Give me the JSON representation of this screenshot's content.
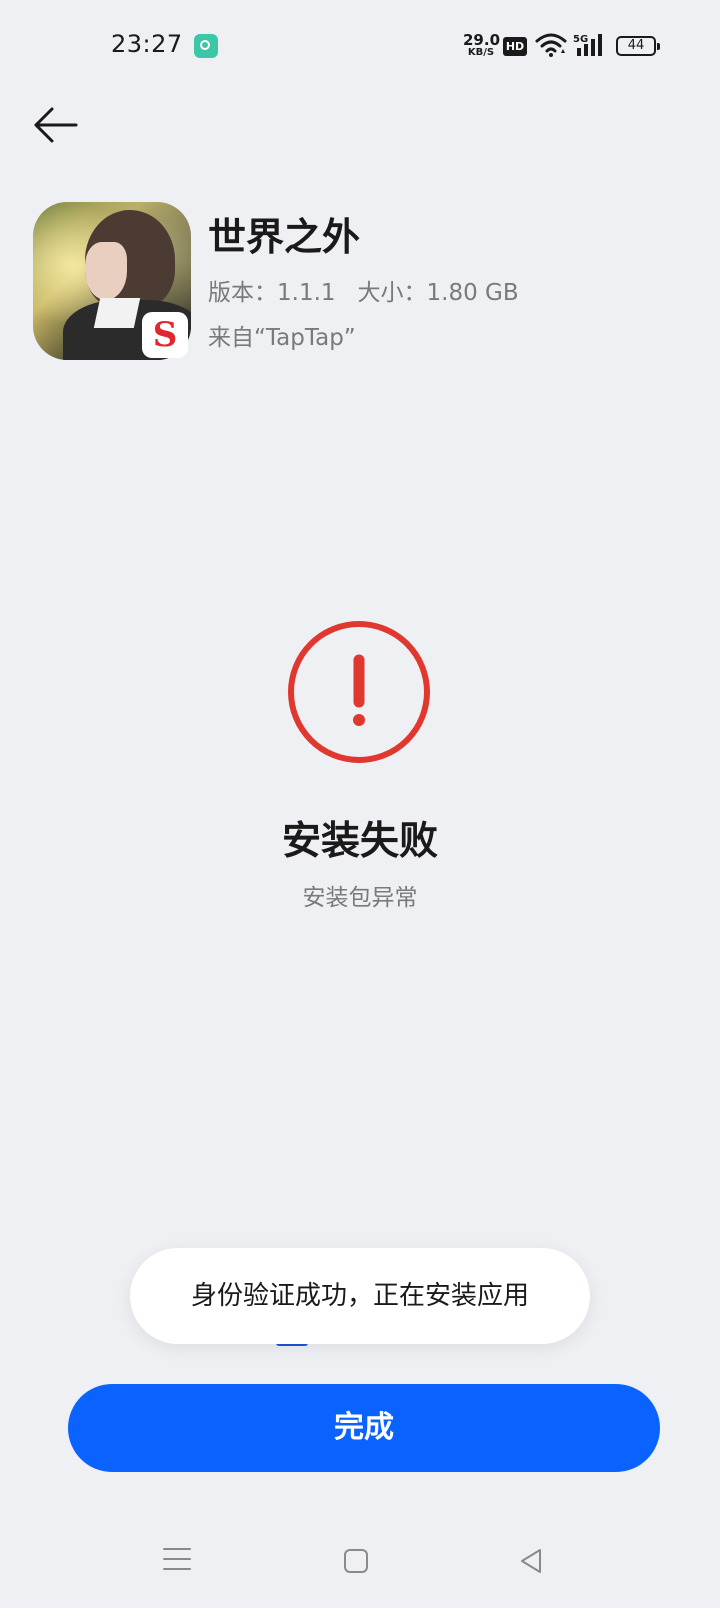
{
  "status_bar": {
    "time": "23:27",
    "net_speed_value": "29.0",
    "net_speed_unit": "KB/S",
    "hd_label": "HD",
    "network_type": "5G",
    "battery": "44"
  },
  "header": {
    "back_icon": "arrow-left-icon"
  },
  "app": {
    "name": "世界之外",
    "version": "版本：1.1.1",
    "size": "大小：1.80 GB",
    "source": "来自“TapTap”"
  },
  "result": {
    "icon": "exclamation-circle-icon",
    "title": "安装失败",
    "reason": "安装包异常"
  },
  "toast": {
    "text": "身份验证成功，正在安装应用"
  },
  "footer": {
    "done_label": "完成"
  },
  "nav": {
    "menu_icon": "menu-icon",
    "home_icon": "home-icon",
    "back_icon": "back-triangle-icon"
  },
  "colors": {
    "accent": "#0a62ff",
    "error": "#e0382f",
    "background": "#eff0f3"
  }
}
